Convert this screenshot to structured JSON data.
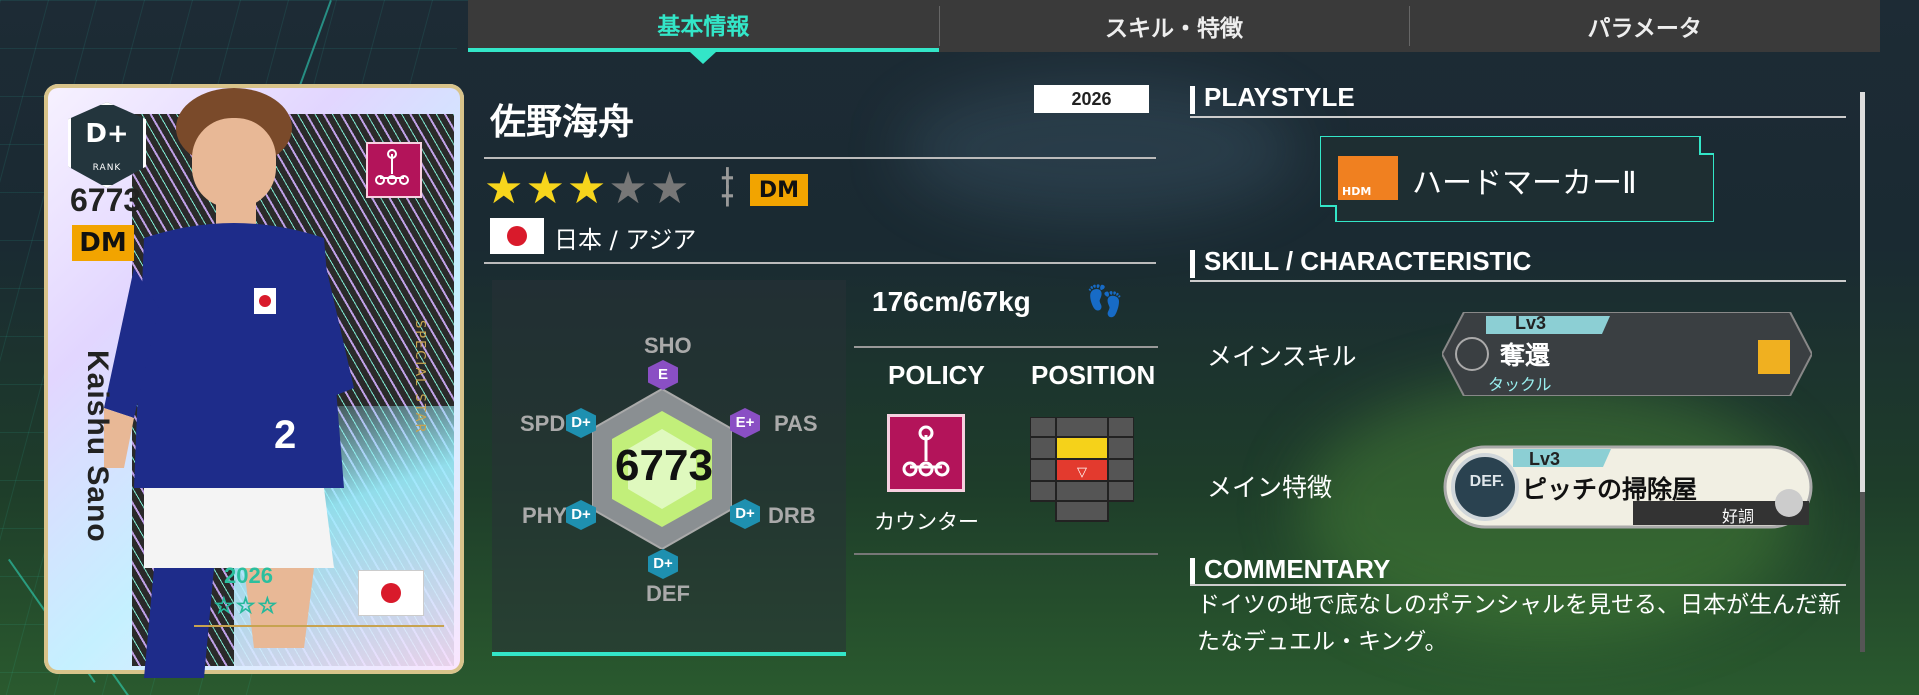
{
  "tabs": [
    {
      "label": "基本情報",
      "active": true
    },
    {
      "label": "スキル・特徴",
      "active": false
    },
    {
      "label": "パラメータ",
      "active": false
    }
  ],
  "card": {
    "rank": "D+",
    "rank_label": "RANK",
    "overall": "6773",
    "position": "DM",
    "name": "Kaishu Sano",
    "special": "SPECIAL STAR",
    "year": "2026",
    "stars": "☆☆☆"
  },
  "player": {
    "name": "佐野海舟",
    "year": "2026",
    "stars_filled": 3,
    "stars_total": 5,
    "position": "DM",
    "nation": "日本 / アジア",
    "body": "176cm/67kg"
  },
  "stats": {
    "overall": "6773",
    "items": [
      {
        "key": "SHO",
        "grade": "E"
      },
      {
        "key": "PAS",
        "grade": "E+"
      },
      {
        "key": "DRB",
        "grade": "D+"
      },
      {
        "key": "DEF",
        "grade": "D+"
      },
      {
        "key": "PHY",
        "grade": "D+"
      },
      {
        "key": "SPD",
        "grade": "D+"
      }
    ]
  },
  "policy": {
    "header": "POLICY",
    "value": "カウンター"
  },
  "position_panel": {
    "header": "POSITION"
  },
  "playstyle": {
    "title": "PLAYSTYLE",
    "badge": "HDM",
    "label": "ハードマーカーⅡ"
  },
  "skill": {
    "title": "SKILL / CHARACTERISTIC",
    "main_skill_label": "メインスキル",
    "main_skill": {
      "level": "Lv3",
      "name": "奪還",
      "category": "タックル"
    },
    "main_trait_label": "メイン特徴",
    "main_trait": {
      "level": "Lv3",
      "name": "ピッチの掃除屋",
      "condition": "好調",
      "badge": "DEF."
    }
  },
  "commentary": {
    "title": "COMMENTARY",
    "text": "ドイツの地で底なしのポテンシャルを見せる、日本が生んだ新たなデュエル・キング。"
  },
  "colors": {
    "accent": "#33e6c8",
    "position": "#f2a400",
    "policy": "#b3145a"
  }
}
